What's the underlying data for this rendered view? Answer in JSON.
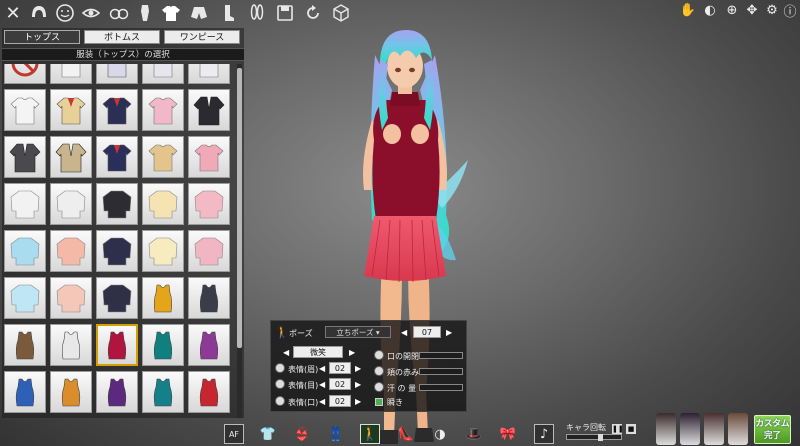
{
  "top_bar": {
    "icons": [
      "close-icon",
      "hair-icon",
      "face-icon",
      "eye-icon",
      "body-icon",
      "chest-icon",
      "tops-icon",
      "bottoms-icon",
      "bra-icon",
      "panties-icon",
      "gloves-icon",
      "stockings-icon",
      "shoes-icon",
      "accessory-icon",
      "bunny-ears-icon",
      "save-icon",
      "reset-icon",
      "cube-icon"
    ],
    "active_icon": "tops-icon",
    "tools": [
      "light-icon",
      "camera-pose-icon",
      "zoom-icon",
      "move-icon",
      "settings-icon"
    ]
  },
  "clothing_panel": {
    "tabs": [
      {
        "label": "トップス",
        "active": true
      },
      {
        "label": "ボトムス",
        "active": false
      },
      {
        "label": "ワンピース",
        "active": false
      }
    ],
    "section_title": "服装（トップス）の選択",
    "columns": 5,
    "items": [
      {
        "kind": "none",
        "color": "#c0392b"
      },
      {
        "kind": "shirt",
        "color": "#f2f2f2"
      },
      {
        "kind": "sailor",
        "color": "#d8d8e8"
      },
      {
        "kind": "shirt",
        "color": "#e6e6ec"
      },
      {
        "kind": "shirt",
        "color": "#ececf0"
      },
      {
        "kind": "shirt",
        "color": "#f4f4f4"
      },
      {
        "kind": "sailor",
        "color": "#e8d199"
      },
      {
        "kind": "sailor",
        "color": "#2b2e55"
      },
      {
        "kind": "shirt",
        "color": "#f0b8c8"
      },
      {
        "kind": "jacket",
        "color": "#2a2a30"
      },
      {
        "kind": "jacket",
        "color": "#4a4a4e"
      },
      {
        "kind": "jacket",
        "color": "#c9b48e"
      },
      {
        "kind": "sailor",
        "color": "#2a2e5a"
      },
      {
        "kind": "shirt",
        "color": "#e3c48c"
      },
      {
        "kind": "shirt",
        "color": "#f0a9b8"
      },
      {
        "kind": "sweater",
        "color": "#f2f2f2"
      },
      {
        "kind": "sweater",
        "color": "#eeeeee"
      },
      {
        "kind": "sweater",
        "color": "#2c2c32"
      },
      {
        "kind": "sweater",
        "color": "#f5e3b2"
      },
      {
        "kind": "sweater",
        "color": "#f3b9c4"
      },
      {
        "kind": "sweater",
        "color": "#a9dcef"
      },
      {
        "kind": "sweater",
        "color": "#f5b9a7"
      },
      {
        "kind": "sweater",
        "color": "#2e2f4a"
      },
      {
        "kind": "sweater",
        "color": "#f7ebc0"
      },
      {
        "kind": "sweater",
        "color": "#f2b5c3"
      },
      {
        "kind": "sweater",
        "color": "#bfe6f5"
      },
      {
        "kind": "sweater",
        "color": "#f5c7b8"
      },
      {
        "kind": "sweater",
        "color": "#2f3045"
      },
      {
        "kind": "tank",
        "color": "#e5a51a"
      },
      {
        "kind": "tank",
        "color": "#3a3d48"
      },
      {
        "kind": "tank",
        "color": "#7b5a3c"
      },
      {
        "kind": "tank",
        "color": "#e8e8e8"
      },
      {
        "kind": "tank",
        "color": "#b0143f"
      },
      {
        "kind": "tank",
        "color": "#0f7f80"
      },
      {
        "kind": "tank",
        "color": "#8d3a96"
      },
      {
        "kind": "tank",
        "color": "#2d60b6"
      },
      {
        "kind": "tank",
        "color": "#d98e2b"
      },
      {
        "kind": "tank",
        "color": "#5b2a7e"
      },
      {
        "kind": "tank",
        "color": "#14808a"
      },
      {
        "kind": "tank",
        "color": "#c52630"
      },
      {
        "kind": "tank",
        "color": "#d9c39a"
      },
      {
        "kind": "tank",
        "color": "#2e7b45"
      },
      {
        "kind": "tank",
        "color": "#1c1c1c"
      },
      {
        "kind": "tank",
        "color": "#ecbfcf"
      },
      {
        "kind": "tank",
        "color": "#f0f0f0"
      }
    ],
    "selected_index": 32
  },
  "pose_panel": {
    "pose_label": "ポーズ",
    "pose_value": "立ちポーズ",
    "pose_number": "07",
    "expression_preset": "微笑",
    "eyebrow_label": "表情(眉)",
    "eyebrow_value": "02",
    "eyes_label": "表情(目)",
    "eyes_value": "02",
    "mouth_label": "表情(口)",
    "mouth_value": "02",
    "mouth_open_label": "口の開閉",
    "mouth_open_level": 0.0,
    "blush_label": "頬の赤み",
    "blush_level": 0.0,
    "sweat_label": "汗 の 量",
    "sweat_level": 0.0,
    "blink_label": "瞬き",
    "blink_checked": true
  },
  "bottom_bar": {
    "icons": [
      "af-icon",
      "tops-toggle-icon",
      "bra-toggle-icon",
      "bottoms-toggle-icon",
      "pose-figure-icon",
      "shoes-toggle-icon",
      "lighting-icon",
      "hat-icon",
      "music-toggle-icon",
      "music-note-icon"
    ],
    "af_label": "AF",
    "rotate_label": "キャラ回転",
    "rotate_level": 0.6,
    "character_thumbs": [
      "#3a2a2a",
      "#2b2030",
      "#4a2e2e",
      "#6a4a3a"
    ],
    "finish_label_line1": "カスタム",
    "finish_label_line2": "完了"
  },
  "character": {
    "hair_top": "#9aa8f0",
    "hair_bottom": "#36e0c8",
    "top_color": "#8a0f2a",
    "skirt_color": "#e0415a",
    "skin": "#f3c8a8"
  }
}
